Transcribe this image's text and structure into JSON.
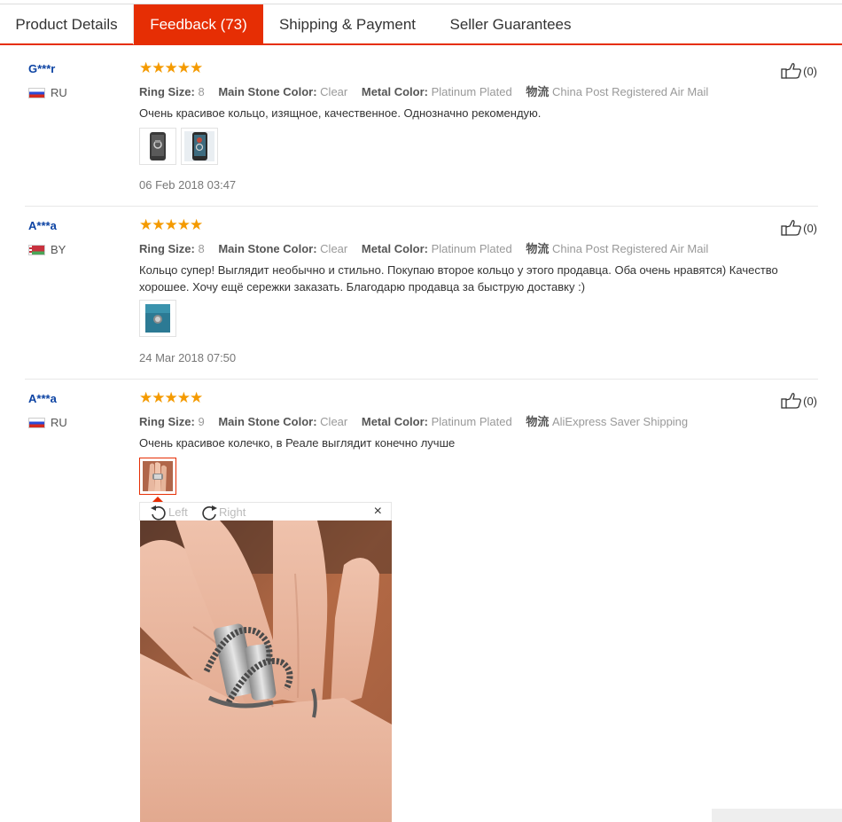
{
  "tabs": [
    {
      "label": "Product Details"
    },
    {
      "label": "Feedback (73)"
    },
    {
      "label": "Shipping & Payment"
    },
    {
      "label": "Seller Guarantees"
    }
  ],
  "labels": {
    "ring_size": "Ring Size:",
    "stone_color": "Main Stone Color:",
    "metal_color": "Metal Color:",
    "logistics": "物流"
  },
  "reviews": [
    {
      "user": "G***r",
      "country": "RU",
      "stars": "★★★★★",
      "ring_size": "8",
      "stone_color": "Clear",
      "metal_color": "Platinum Plated",
      "shipping": "China Post Registered Air Mail",
      "comment": "Очень красивое кольцо, изящное, качественное. Однозначно рекомендую.",
      "date": "06 Feb 2018 03:47",
      "likes": "(0)"
    },
    {
      "user": "A***a",
      "country": "BY",
      "stars": "★★★★★",
      "ring_size": "8",
      "stone_color": "Clear",
      "metal_color": "Platinum Plated",
      "shipping": "China Post Registered Air Mail",
      "comment": "Кольцо супер! Выглядит необычно и стильно. Покупаю второе кольцо у этого продавца. Оба очень нравятся) Качество хорошее. Хочу ещё сережки заказать. Благодарю продавца за быструю доставку :)",
      "date": "24 Mar 2018 07:50",
      "likes": "(0)"
    },
    {
      "user": "A***a",
      "country": "RU",
      "stars": "★★★★★",
      "ring_size": "9",
      "stone_color": "Clear",
      "metal_color": "Platinum Plated",
      "shipping": "AliExpress Saver Shipping",
      "comment": "Очень красивое колечко, в Реале выглядит конечно лучше",
      "likes": "(0)"
    }
  ],
  "viewer": {
    "rotate_left": "Left",
    "rotate_right": "Right",
    "close": "×"
  },
  "colors": {
    "accent": "#e62e04",
    "star": "#f49a00",
    "username": "#0c43a3"
  }
}
